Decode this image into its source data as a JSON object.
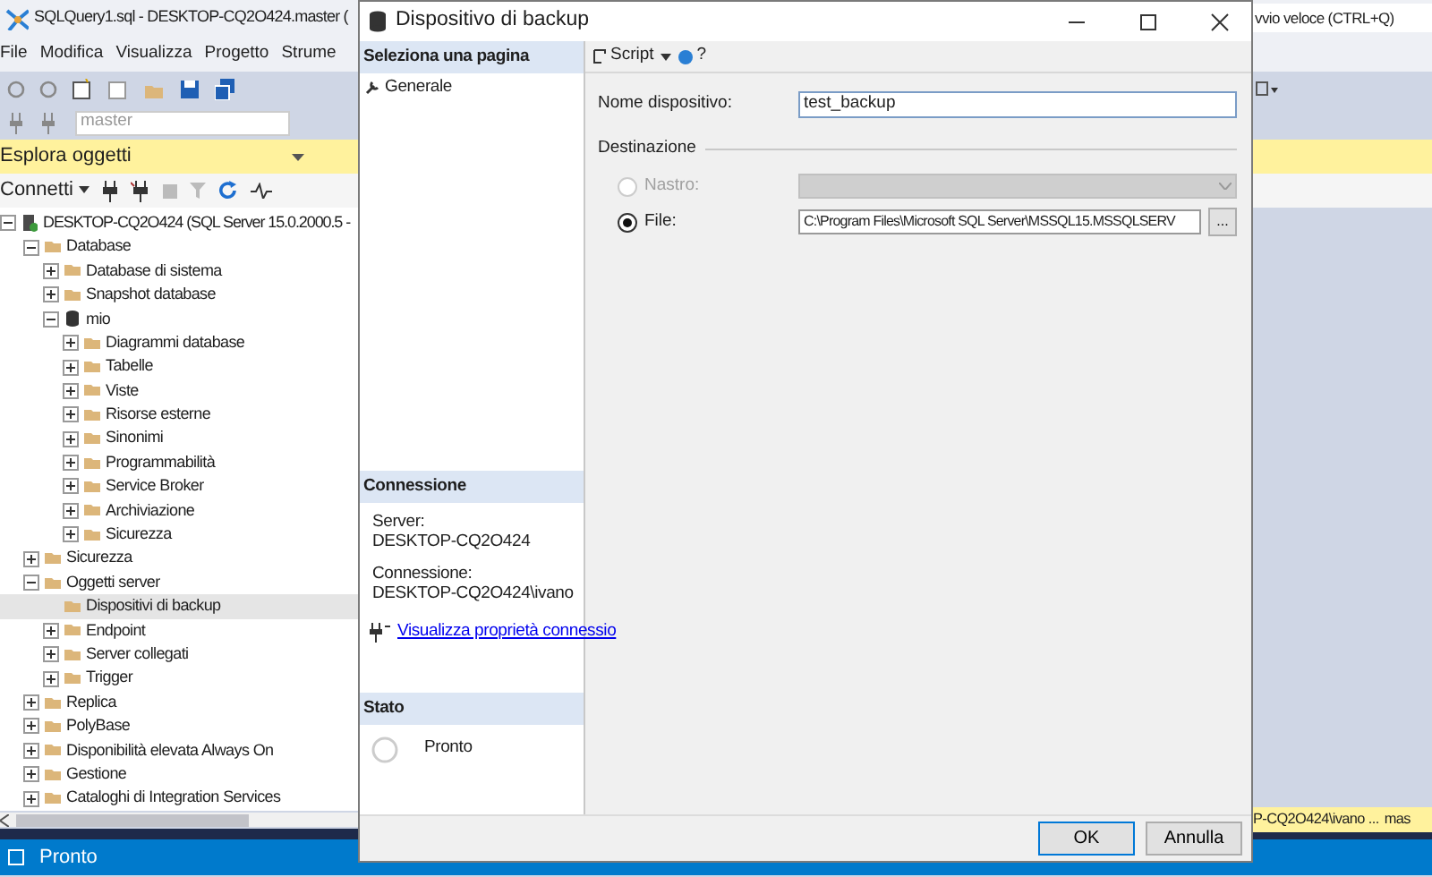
{
  "app": {
    "title": "SQLQuery1.sql - DESKTOP-CQ2O424.master (",
    "quick_launch": "vvio veloce (CTRL+Q)",
    "menu": [
      "File",
      "Modifica",
      "Visualizza",
      "Progetto",
      "Strume"
    ],
    "database_selector": "master"
  },
  "object_explorer": {
    "title": "Esplora oggetti",
    "connect": "Connetti",
    "tree": [
      {
        "label": "DESKTOP-CQ2O424 (SQL Server 15.0.2000.5 -",
        "kind": "server",
        "expanded": true,
        "selected": false,
        "children": [
          {
            "label": "Database",
            "kind": "folder",
            "expanded": true,
            "selected": false,
            "children": [
              {
                "label": "Database di sistema",
                "kind": "folder",
                "expanded": false,
                "selected": false
              },
              {
                "label": "Snapshot database",
                "kind": "folder",
                "expanded": false,
                "selected": false
              },
              {
                "label": "mio",
                "kind": "database",
                "expanded": true,
                "selected": false,
                "children": [
                  {
                    "label": "Diagrammi database",
                    "kind": "folder",
                    "expanded": false,
                    "selected": false
                  },
                  {
                    "label": "Tabelle",
                    "kind": "folder",
                    "expanded": false,
                    "selected": false
                  },
                  {
                    "label": "Viste",
                    "kind": "folder",
                    "expanded": false,
                    "selected": false
                  },
                  {
                    "label": "Risorse esterne",
                    "kind": "folder",
                    "expanded": false,
                    "selected": false
                  },
                  {
                    "label": "Sinonimi",
                    "kind": "folder",
                    "expanded": false,
                    "selected": false
                  },
                  {
                    "label": "Programmabilità",
                    "kind": "folder",
                    "expanded": false,
                    "selected": false
                  },
                  {
                    "label": "Service Broker",
                    "kind": "folder",
                    "expanded": false,
                    "selected": false
                  },
                  {
                    "label": "Archiviazione",
                    "kind": "folder",
                    "expanded": false,
                    "selected": false
                  },
                  {
                    "label": "Sicurezza",
                    "kind": "folder",
                    "expanded": false,
                    "selected": false
                  }
                ]
              }
            ]
          },
          {
            "label": "Sicurezza",
            "kind": "folder",
            "expanded": false,
            "selected": false
          },
          {
            "label": "Oggetti server",
            "kind": "folder",
            "expanded": true,
            "selected": false,
            "children": [
              {
                "label": "Dispositivi di backup",
                "kind": "folder",
                "selected": true
              },
              {
                "label": "Endpoint",
                "kind": "folder",
                "expanded": false,
                "selected": false
              },
              {
                "label": "Server collegati",
                "kind": "folder",
                "expanded": false,
                "selected": false
              },
              {
                "label": "Trigger",
                "kind": "folder",
                "expanded": false,
                "selected": false
              }
            ]
          },
          {
            "label": "Replica",
            "kind": "folder",
            "expanded": false,
            "selected": false
          },
          {
            "label": "PolyBase",
            "kind": "folder",
            "expanded": false,
            "selected": false
          },
          {
            "label": "Disponibilità elevata Always On",
            "kind": "folder",
            "expanded": false,
            "selected": false
          },
          {
            "label": "Gestione",
            "kind": "folder",
            "expanded": false,
            "selected": false
          },
          {
            "label": "Cataloghi di Integration Services",
            "kind": "folder",
            "expanded": false,
            "selected": false
          }
        ]
      }
    ]
  },
  "status_bar": {
    "text": "Pronto",
    "connection": "P-CQ2O424\\ivano ...",
    "database": "mas"
  },
  "dialog": {
    "title": "Dispositivo di backup",
    "pages_header": "Seleziona una pagina",
    "pages": [
      {
        "label": "Generale",
        "selected": true
      }
    ],
    "connection": {
      "header": "Connessione",
      "server_label": "Server:",
      "server": "DESKTOP-CQ2O424",
      "connection_label": "Connessione:",
      "connection": "DESKTOP-CQ2O424\\ivano",
      "link": "Visualizza proprietà connessio"
    },
    "progress": {
      "header": "Stato",
      "text": "Pronto"
    },
    "toolbar": {
      "script": "Script",
      "help": "?"
    },
    "device_name": {
      "label": "Nome dispositivo:",
      "value": "test_backup"
    },
    "destination": {
      "label": "Destinazione",
      "options": [
        {
          "label": "Nastro:",
          "selected": false,
          "disabled": true,
          "kind": "dropdown"
        },
        {
          "label": "File:",
          "selected": true,
          "disabled": false,
          "kind": "path",
          "value": "C:\\Program Files\\Microsoft SQL Server\\MSSQL15.MSSQLSERV",
          "browse": "..."
        }
      ]
    },
    "buttons": [
      "OK",
      "Annulla"
    ]
  }
}
